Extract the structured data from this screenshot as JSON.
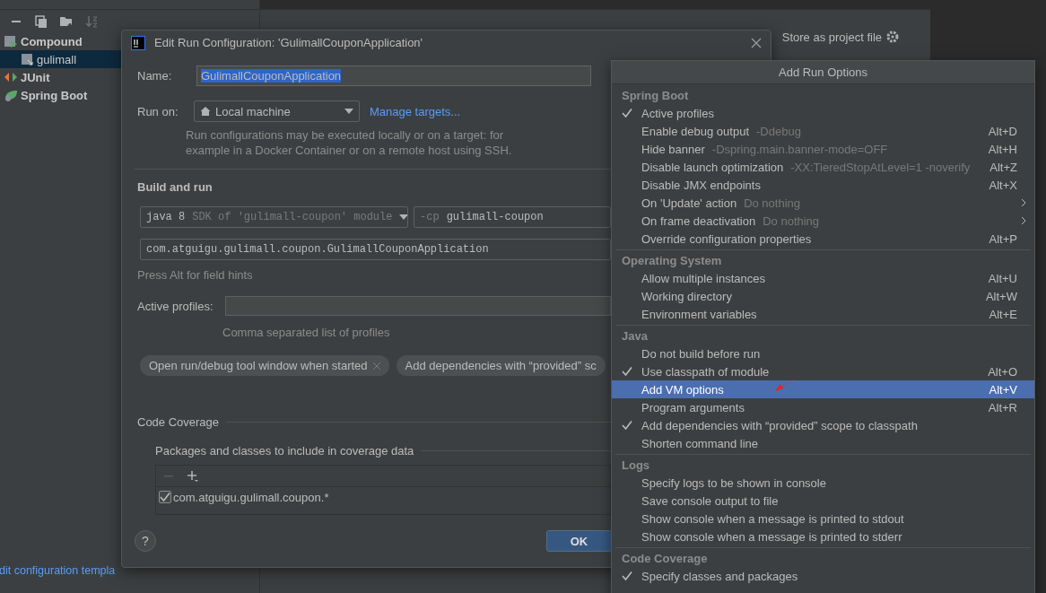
{
  "background_window": {
    "tree": [
      {
        "label": "Compound",
        "selected": false,
        "children": [
          {
            "label": "gulimall",
            "selected": true
          }
        ]
      },
      {
        "label": "JUnit",
        "selected": false
      },
      {
        "label": "Spring Boot",
        "selected": false
      }
    ],
    "store_as_project_file": "Store as project file",
    "templates_link": "dit configuration templa"
  },
  "dialog": {
    "title": "Edit Run Configuration: 'GulimallCouponApplication'",
    "name_label": "Name:",
    "name_value": "GulimallCouponApplication",
    "name_value_selected": true,
    "run_on_label": "Run on:",
    "run_on_value": "Local machine",
    "manage_targets": "Manage targets...",
    "run_on_hint": "Run configurations may be executed locally or on a target: for example in a Docker Container or on a remote host using SSH.",
    "build_and_run": "Build and run",
    "jre": {
      "value": "java 8",
      "hint": "SDK of 'gulimall-coupon' module"
    },
    "classpath": {
      "flag": "-cp",
      "value": "gulimall-coupon"
    },
    "main_class": "com.atguigu.gulimall.coupon.GulimallCouponApplication",
    "field_hints": "Press Alt for field hints",
    "active_profiles_label": "Active profiles:",
    "active_profiles_hint": "Comma separated list of profiles",
    "chips": [
      {
        "label": "Open run/debug tool window when started",
        "removable": true
      },
      {
        "label": "Add dependencies with “provided” sc",
        "removable": false
      }
    ],
    "code_coverage": {
      "title": "Code Coverage",
      "packages_label": "Packages and classes to include in coverage data",
      "entries": [
        {
          "pattern": "com.atguigu.gulimall.coupon.*",
          "checked": true
        }
      ]
    },
    "help": "?",
    "ok": "OK"
  },
  "popup": {
    "title": "Add Run Options",
    "groups": [
      {
        "title": "Spring Boot",
        "items": [
          {
            "label": "Active profiles",
            "checked": true,
            "selected": false,
            "submenu": false
          },
          {
            "label": "Enable debug output",
            "hint": "-Ddebug",
            "shortcut": "Alt+D",
            "checked": false,
            "selected": false,
            "submenu": false
          },
          {
            "label": "Hide banner",
            "hint": "-Dspring.main.banner-mode=OFF",
            "shortcut": "Alt+H",
            "checked": false,
            "selected": false,
            "submenu": false
          },
          {
            "label": "Disable launch optimization",
            "hint": "-XX:TieredStopAtLevel=1 -noverify",
            "shortcut": "Alt+Z",
            "checked": false,
            "selected": false,
            "submenu": false
          },
          {
            "label": "Disable JMX endpoints",
            "shortcut": "Alt+X",
            "checked": false,
            "selected": false,
            "submenu": false
          },
          {
            "label": "On 'Update' action",
            "hint": "Do nothing",
            "checked": false,
            "selected": false,
            "submenu": true
          },
          {
            "label": "On frame deactivation",
            "hint": "Do nothing",
            "checked": false,
            "selected": false,
            "submenu": true
          },
          {
            "label": "Override configuration properties",
            "shortcut": "Alt+P",
            "checked": false,
            "selected": false,
            "submenu": false
          }
        ]
      },
      {
        "title": "Operating System",
        "items": [
          {
            "label": "Allow multiple instances",
            "shortcut": "Alt+U",
            "checked": false,
            "selected": false,
            "submenu": false
          },
          {
            "label": "Working directory",
            "shortcut": "Alt+W",
            "checked": false,
            "selected": false,
            "submenu": false
          },
          {
            "label": "Environment variables",
            "shortcut": "Alt+E",
            "checked": false,
            "selected": false,
            "submenu": false
          }
        ]
      },
      {
        "title": "Java",
        "items": [
          {
            "label": "Do not build before run",
            "checked": false,
            "selected": false,
            "submenu": false
          },
          {
            "label": "Use classpath of module",
            "shortcut": "Alt+O",
            "checked": true,
            "selected": false,
            "submenu": false
          },
          {
            "label": "Add VM options",
            "shortcut": "Alt+V",
            "checked": false,
            "selected": true,
            "submenu": false
          },
          {
            "label": "Program arguments",
            "shortcut": "Alt+R",
            "checked": false,
            "selected": false,
            "submenu": false
          },
          {
            "label": "Add dependencies with “provided” scope to classpath",
            "checked": true,
            "selected": false,
            "submenu": false
          },
          {
            "label": "Shorten command line",
            "checked": false,
            "selected": false,
            "submenu": false
          }
        ]
      },
      {
        "title": "Logs",
        "items": [
          {
            "label": "Specify logs to be shown in console",
            "checked": false,
            "selected": false,
            "submenu": false
          },
          {
            "label": "Save console output to file",
            "checked": false,
            "selected": false,
            "submenu": false
          },
          {
            "label": "Show console when a message is printed to stdout",
            "checked": false,
            "selected": false,
            "submenu": false
          },
          {
            "label": "Show console when a message is printed to stderr",
            "checked": false,
            "selected": false,
            "submenu": false
          }
        ]
      },
      {
        "title": "Code Coverage",
        "items": [
          {
            "label": "Specify classes and packages",
            "checked": true,
            "selected": false,
            "submenu": false
          }
        ]
      }
    ]
  }
}
